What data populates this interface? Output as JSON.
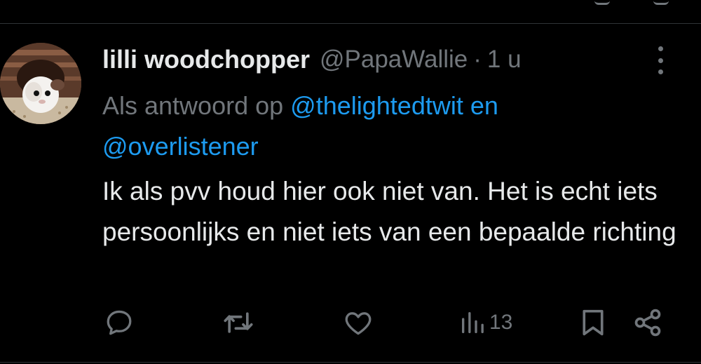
{
  "tweet": {
    "display_name": "lilli woodchopper",
    "handle": "@PapaWallie",
    "separator": "·",
    "time": "1 u",
    "reply_prefix": "Als antwoord op",
    "reply_mention_1": "@thelightedtwit",
    "reply_connector": "en",
    "reply_mention_2": "@overlistener",
    "text": "Ik als pvv houd hier ook niet van. Het is echt iets persoonlijks en niet iets van een bepaalde richting"
  },
  "actions": {
    "reply_icon": "reply-icon",
    "retweet_icon": "retweet-icon",
    "like_icon": "like-icon",
    "views_icon": "views-icon",
    "views_count": "13",
    "bookmark_icon": "bookmark-icon",
    "share_icon": "share-icon"
  },
  "colors": {
    "background": "#000000",
    "text_primary": "#e7e9ea",
    "text_secondary": "#71767b",
    "link": "#1d9bf0"
  }
}
